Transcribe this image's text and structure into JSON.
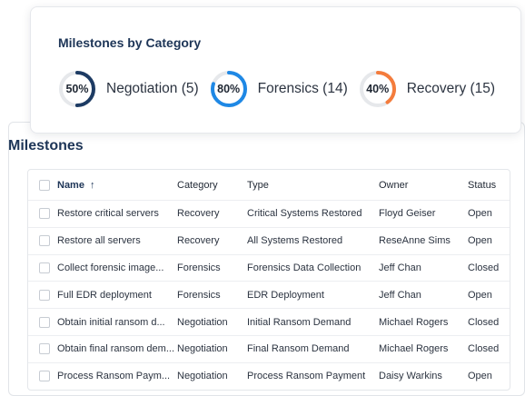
{
  "categories_card": {
    "title": "Milestones by Category",
    "items": [
      {
        "percent": "50%",
        "fraction": 0.5,
        "label": "Negotiation (5)",
        "color": "#1d3b63"
      },
      {
        "percent": "80%",
        "fraction": 0.8,
        "label": "Forensics (14)",
        "color": "#1e88e5"
      },
      {
        "percent": "40%",
        "fraction": 0.4,
        "label": "Recovery (15)",
        "color": "#f47c3c"
      }
    ],
    "track_color": "#e6e8eb"
  },
  "milestones": {
    "title": "Milestones",
    "columns": {
      "name": "Name",
      "sort_arrow": "↑",
      "category": "Category",
      "type": "Type",
      "owner": "Owner",
      "status": "Status"
    },
    "rows": [
      {
        "name": "Restore critical servers",
        "category": "Recovery",
        "type": "Critical Systems Restored",
        "owner": "Floyd Geiser",
        "status": "Open"
      },
      {
        "name": "Restore all servers",
        "category": "Recovery",
        "type": "All Systems Restored",
        "owner": "ReseAnne Sims",
        "status": "Open"
      },
      {
        "name": "Collect forensic image...",
        "category": "Forensics",
        "type": "Forensics Data Collection",
        "owner": "Jeff Chan",
        "status": "Closed"
      },
      {
        "name": "Full EDR deployment",
        "category": "Forensics",
        "type": "EDR Deployment",
        "owner": "Jeff Chan",
        "status": "Open"
      },
      {
        "name": "Obtain initial ransom d...",
        "category": "Negotiation",
        "type": "Initial Ransom Demand",
        "owner": "Michael Rogers",
        "status": "Closed"
      },
      {
        "name": "Obtain final ransom dem...",
        "category": "Negotiation",
        "type": "Final Ransom Demand",
        "owner": "Michael Rogers",
        "status": "Closed"
      },
      {
        "name": "Process Ransom Paym...",
        "category": "Negotiation",
        "type": "Process Ransom Payment",
        "owner": "Daisy Warkins",
        "status": "Open"
      }
    ]
  }
}
